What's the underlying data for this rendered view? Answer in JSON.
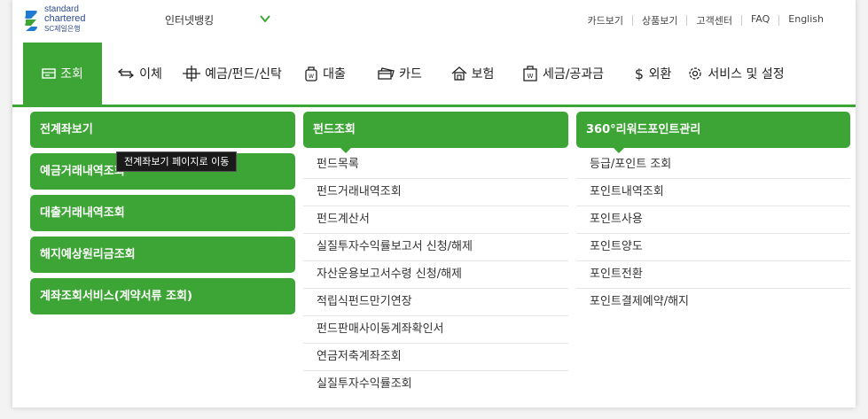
{
  "brand": {
    "line1": "standard",
    "line2": "chartered",
    "line3": "SC제일은행",
    "colors": {
      "blue": "#2a4b8d",
      "green": "#3da535"
    }
  },
  "topbar": {
    "banking_select": "인터넷뱅킹",
    "util_links": [
      "카드보기",
      "상품보기",
      "고객센터",
      "FAQ",
      "English"
    ]
  },
  "nav": {
    "items": [
      {
        "label": "조회",
        "icon": "inquiry-icon"
      },
      {
        "label": "이체",
        "icon": "transfer-icon"
      },
      {
        "label": "예금/펀드/신탁",
        "icon": "deposit-icon"
      },
      {
        "label": "대출",
        "icon": "loan-icon"
      },
      {
        "label": "카드",
        "icon": "card-icon"
      },
      {
        "label": "보험",
        "icon": "insurance-icon"
      },
      {
        "label": "세금/공과금",
        "icon": "tax-icon"
      },
      {
        "label": "외환",
        "icon": "dollar-icon"
      },
      {
        "label": "서비스 및 설정",
        "icon": "gear-icon"
      }
    ]
  },
  "submenu": {
    "col1": [
      "전계좌보기",
      "예금거래내역조회",
      "대출거래내역조회",
      "해지예상원리금조회",
      "계좌조회서비스(계약서류 조회)"
    ],
    "col2": {
      "title": "펀드조회",
      "items": [
        "펀드목록",
        "펀드거래내역조회",
        "펀드계산서",
        "실질투자수익률보고서 신청/해제",
        "자산운용보고서수령 신청/해제",
        "적립식펀드만기연장",
        "펀드판매사이동계좌확인서",
        "연금저축계좌조회",
        "실질투자수익률조회"
      ]
    },
    "col3": {
      "title": "360°리워드포인트관리",
      "items": [
        "등급/포인트 조회",
        "포인트내역조회",
        "포인트사용",
        "포인트양도",
        "포인트전환",
        "포인트결제예약/해지"
      ]
    }
  },
  "tooltip": "전계좌보기 페이지로 이동"
}
